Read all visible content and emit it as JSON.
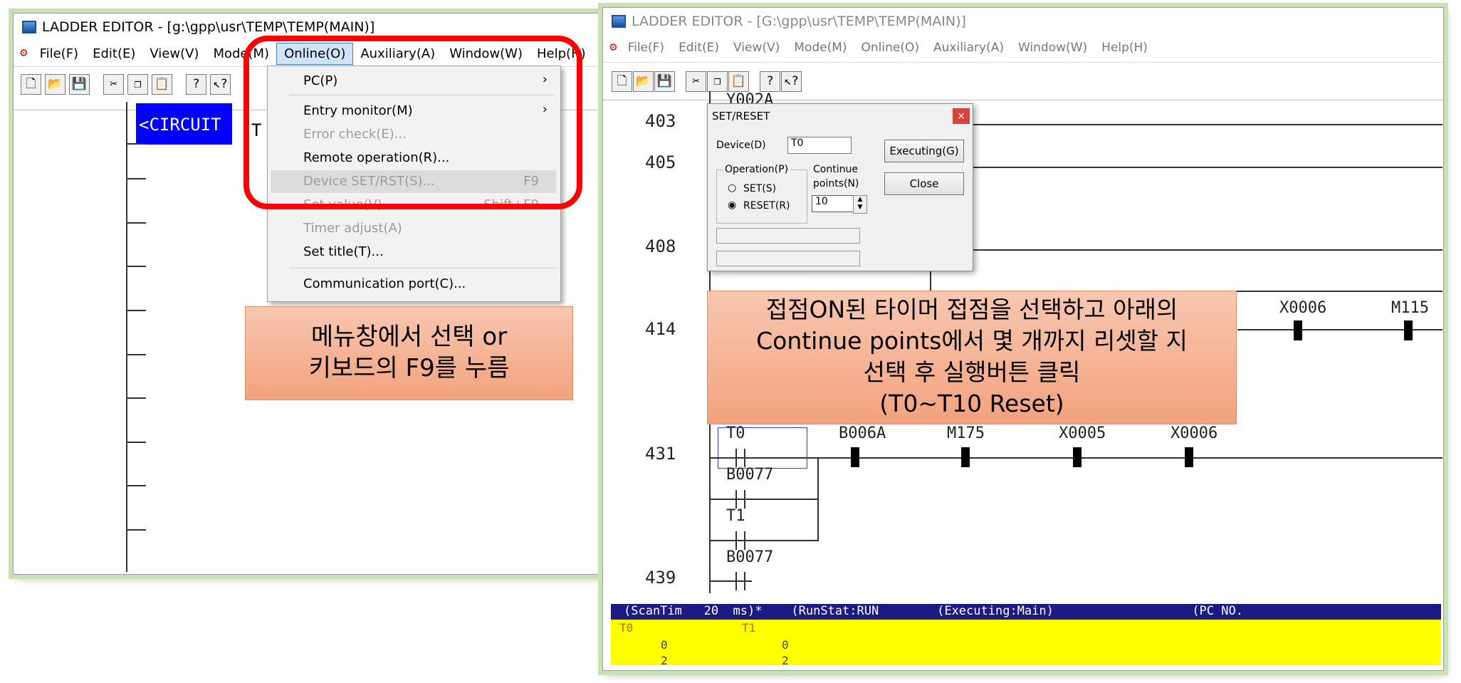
{
  "left_window": {
    "title": "LADDER EDITOR - [g:\\gpp\\usr\\TEMP\\TEMP(MAIN)]",
    "menu": [
      "File(F)",
      "Edit(E)",
      "View(V)",
      "Mode(M)",
      "Online(O)",
      "Auxiliary(A)",
      "Window(W)",
      "Help(H)"
    ],
    "circuit_label": "<CIRCUIT",
    "circuit_tail": "T",
    "dropdown": {
      "pc": "PC(P)",
      "entry_monitor": "Entry monitor(M)",
      "error_check": "Error check(E)...",
      "remote_operation": "Remote operation(R)...",
      "device_setrst": "Device SET/RST(S)...",
      "device_setrst_key": "F9",
      "set_value": "Set value(V)...",
      "set_value_key": "Shift+F9",
      "timer_adjust": "Timer adjust(A)",
      "set_title": "Set title(T)...",
      "comm_port": "Communication port(C)..."
    },
    "callout_line1": "메뉴창에서 선택 or",
    "callout_line2": "키보드의 F9를 누름"
  },
  "right_window": {
    "title": "LADDER EDITOR - [G:\\gpp\\usr\\TEMP\\TEMP(MAIN)]",
    "menu": [
      "File(F)",
      "Edit(E)",
      "View(V)",
      "Mode(M)",
      "Online(O)",
      "Auxiliary(A)",
      "Window(W)",
      "Help(H)"
    ],
    "step_numbers": [
      "403",
      "405",
      "408",
      "414",
      "431",
      "439"
    ],
    "devices": {
      "y002a": "Y002A",
      "x0006_414": "X0006",
      "m115": "M115",
      "t0": "T0",
      "b006a": "B006A",
      "m175": "M175",
      "x0005": "X0005",
      "x0006_431": "X0006",
      "b0077_a": "B0077",
      "t1": "T1",
      "b0077_b": "B0077"
    },
    "dialog": {
      "title": "SET/RESET",
      "device_label": "Device(D)",
      "device_value": "T0",
      "executing_button": "Executing(G)",
      "close_button": "Close",
      "operation_label": "Operation(P)",
      "set_option": "SET(S)",
      "reset_option": "RESET(R)",
      "continue_label_1": "Continue",
      "continue_label_2": "points(N)",
      "continue_value": "10"
    },
    "callout_lines": [
      "접점ON된 타이머 접점을 선택하고 아래의",
      "Continue points에서 몇 개까지 리셋할 지",
      "선택 후 실행버튼 클릭",
      "(T0~T10 Reset)"
    ],
    "status_bar": "(ScanTim   20  ms)*    (RunStat:RUN        (Executing:Main)                   (PC NO.",
    "monitor": {
      "t0_label": "T0",
      "t1_label": "T1",
      "t0_value": "0",
      "t1_value": "0",
      "t0_value2": "2",
      "t1_value2": "2"
    }
  }
}
